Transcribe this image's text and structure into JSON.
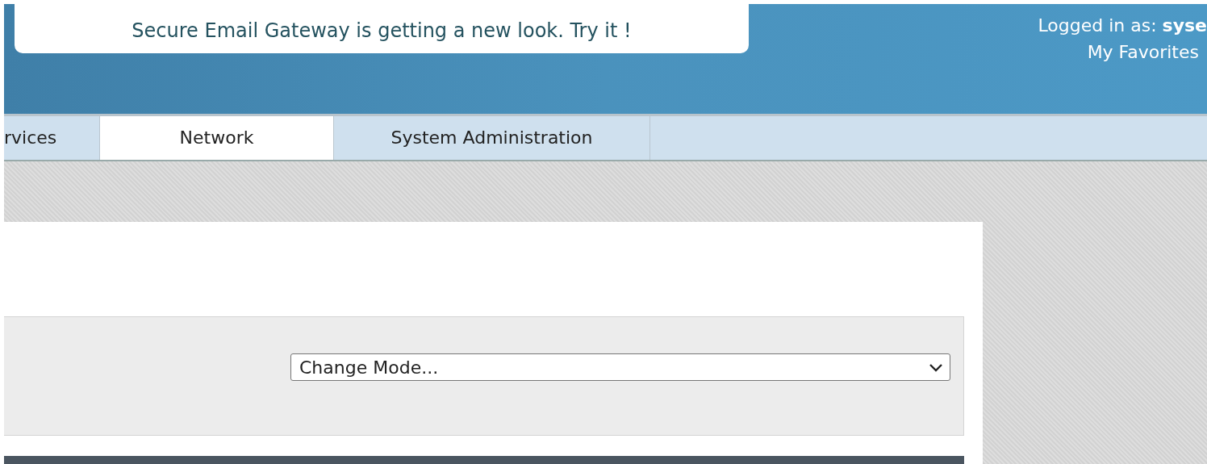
{
  "banner": {
    "text": "Secure Email Gateway is getting a new look. Try it !"
  },
  "user_info": {
    "logged_in": "Logged in as: **syse**",
    "favorites_link": "My Favorites"
  },
  "tabs": [
    {
      "label": "rvices",
      "selected": false
    },
    {
      "label": "Network",
      "selected": true
    },
    {
      "label": "System Administration",
      "selected": false
    }
  ],
  "mode_select": {
    "value": "Change Mode..."
  }
}
